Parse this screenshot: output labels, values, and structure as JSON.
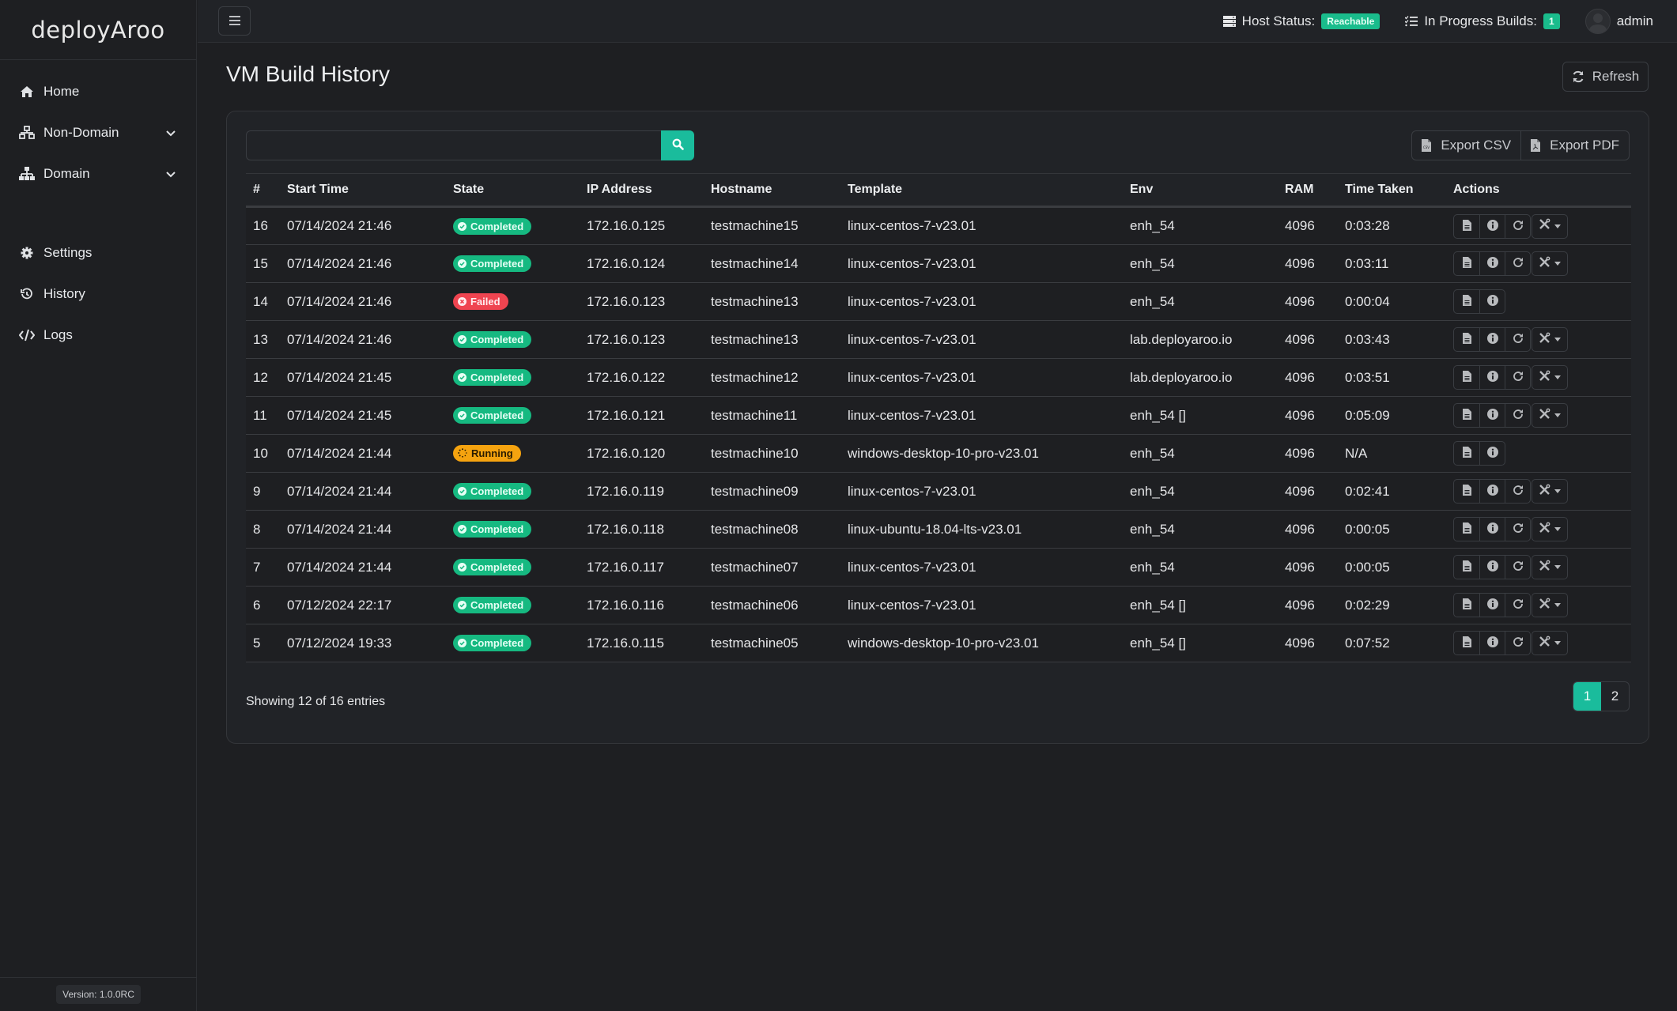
{
  "brand": {
    "name": "deployAroo"
  },
  "sidebar": {
    "items": [
      {
        "label": "Home",
        "icon": "home-icon",
        "has_chevron": false
      },
      {
        "label": "Non-Domain",
        "icon": "network-icon",
        "has_chevron": true
      },
      {
        "label": "Domain",
        "icon": "sitemap-icon",
        "has_chevron": true
      },
      {
        "label": "Settings",
        "icon": "gear-icon",
        "has_chevron": false
      },
      {
        "label": "History",
        "icon": "history-icon",
        "has_chevron": false
      },
      {
        "label": "Logs",
        "icon": "code-icon",
        "has_chevron": false
      }
    ],
    "version": "Version: 1.0.0RC"
  },
  "topbar": {
    "host_status_label": "Host Status:",
    "host_status_value": "Reachable",
    "in_progress_label": "In Progress Builds:",
    "in_progress_count": "1",
    "user": "admin"
  },
  "page": {
    "title": "VM Build History",
    "refresh_label": "Refresh"
  },
  "toolbar": {
    "search_value": "",
    "search_placeholder": "",
    "export_csv_label": "Export CSV",
    "export_pdf_label": "Export PDF"
  },
  "table": {
    "columns": [
      "#",
      "Start Time",
      "State",
      "IP Address",
      "Hostname",
      "Template",
      "Env",
      "RAM",
      "Time Taken",
      "Actions"
    ],
    "rows": [
      {
        "id": "16",
        "start": "07/14/2024 21:46",
        "state": "Completed",
        "ip": "172.16.0.125",
        "host": "testmachine15",
        "template": "linux-centos-7-v23.01",
        "env": "enh_54",
        "ram": "4096",
        "time": "0:03:28",
        "full_actions": true
      },
      {
        "id": "15",
        "start": "07/14/2024 21:46",
        "state": "Completed",
        "ip": "172.16.0.124",
        "host": "testmachine14",
        "template": "linux-centos-7-v23.01",
        "env": "enh_54",
        "ram": "4096",
        "time": "0:03:11",
        "full_actions": true
      },
      {
        "id": "14",
        "start": "07/14/2024 21:46",
        "state": "Failed",
        "ip": "172.16.0.123",
        "host": "testmachine13",
        "template": "linux-centos-7-v23.01",
        "env": "enh_54",
        "ram": "4096",
        "time": "0:00:04",
        "full_actions": false
      },
      {
        "id": "13",
        "start": "07/14/2024 21:46",
        "state": "Completed",
        "ip": "172.16.0.123",
        "host": "testmachine13",
        "template": "linux-centos-7-v23.01",
        "env": "lab.deployaroo.io",
        "ram": "4096",
        "time": "0:03:43",
        "full_actions": true
      },
      {
        "id": "12",
        "start": "07/14/2024 21:45",
        "state": "Completed",
        "ip": "172.16.0.122",
        "host": "testmachine12",
        "template": "linux-centos-7-v23.01",
        "env": "lab.deployaroo.io",
        "ram": "4096",
        "time": "0:03:51",
        "full_actions": true
      },
      {
        "id": "11",
        "start": "07/14/2024 21:45",
        "state": "Completed",
        "ip": "172.16.0.121",
        "host": "testmachine11",
        "template": "linux-centos-7-v23.01",
        "env": "enh_54 []",
        "ram": "4096",
        "time": "0:05:09",
        "full_actions": true
      },
      {
        "id": "10",
        "start": "07/14/2024 21:44",
        "state": "Running",
        "ip": "172.16.0.120",
        "host": "testmachine10",
        "template": "windows-desktop-10-pro-v23.01",
        "env": "enh_54",
        "ram": "4096",
        "time": "N/A",
        "full_actions": false
      },
      {
        "id": "9",
        "start": "07/14/2024 21:44",
        "state": "Completed",
        "ip": "172.16.0.119",
        "host": "testmachine09",
        "template": "linux-centos-7-v23.01",
        "env": "enh_54",
        "ram": "4096",
        "time": "0:02:41",
        "full_actions": true
      },
      {
        "id": "8",
        "start": "07/14/2024 21:44",
        "state": "Completed",
        "ip": "172.16.0.118",
        "host": "testmachine08",
        "template": "linux-ubuntu-18.04-lts-v23.01",
        "env": "enh_54",
        "ram": "4096",
        "time": "0:00:05",
        "full_actions": true
      },
      {
        "id": "7",
        "start": "07/14/2024 21:44",
        "state": "Completed",
        "ip": "172.16.0.117",
        "host": "testmachine07",
        "template": "linux-centos-7-v23.01",
        "env": "enh_54",
        "ram": "4096",
        "time": "0:00:05",
        "full_actions": true
      },
      {
        "id": "6",
        "start": "07/12/2024 22:17",
        "state": "Completed",
        "ip": "172.16.0.116",
        "host": "testmachine06",
        "template": "linux-centos-7-v23.01",
        "env": "enh_54 []",
        "ram": "4096",
        "time": "0:02:29",
        "full_actions": true
      },
      {
        "id": "5",
        "start": "07/12/2024 19:33",
        "state": "Completed",
        "ip": "172.16.0.115",
        "host": "testmachine05",
        "template": "windows-desktop-10-pro-v23.01",
        "env": "enh_54 []",
        "ram": "4096",
        "time": "0:07:52",
        "full_actions": true
      }
    ]
  },
  "footer": {
    "showing": "Showing 12 of 16 entries",
    "pages": [
      "1",
      "2"
    ],
    "active_page": "1"
  },
  "colors": {
    "accent": "#1abc9c",
    "completed": "#16b981",
    "failed": "#ef4450",
    "running": "#f5a30f"
  }
}
